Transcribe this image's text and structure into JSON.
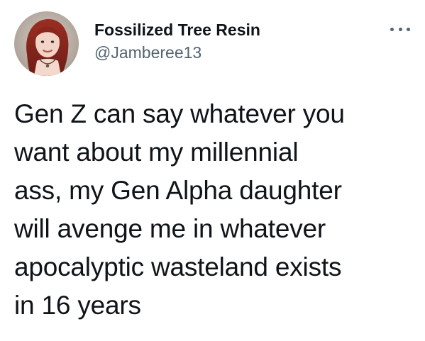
{
  "author": {
    "display_name": "Fossilized Tree Resin",
    "handle": "@Jamberee13",
    "avatar_icon": "profile-photo",
    "more_icon": "more-horizontal-icon"
  },
  "tweet": {
    "lines": [
      "Gen Z can say whatever you",
      "want about my millennial",
      "ass, my Gen Alpha daughter",
      "will avenge me in whatever",
      "apocalyptic wasteland exists",
      "in 16 years"
    ]
  },
  "colors": {
    "text_primary": "#0f1419",
    "text_secondary": "#536471",
    "background": "#ffffff"
  }
}
